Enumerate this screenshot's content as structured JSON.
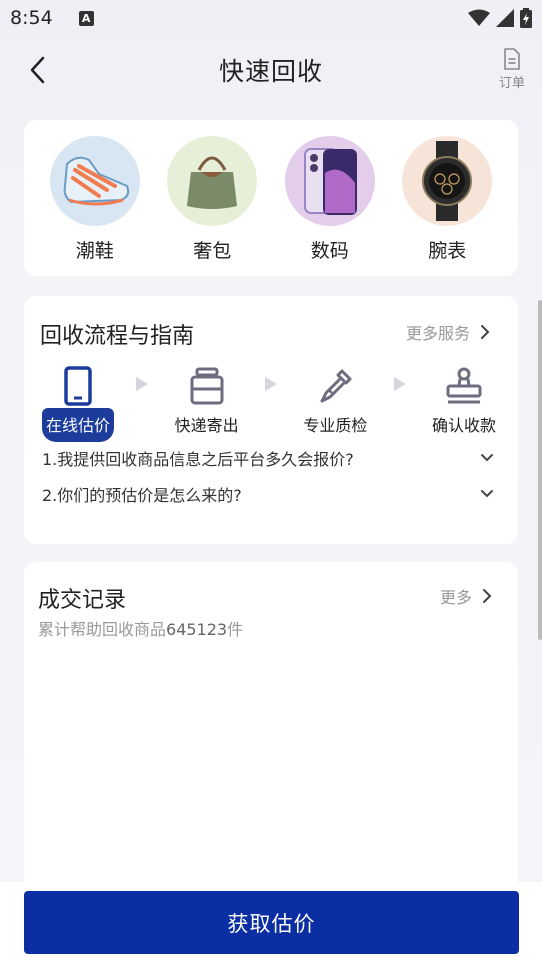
{
  "status": {
    "time": "8:54",
    "notif_letter": "A"
  },
  "nav": {
    "title": "快速回收",
    "order_label": "订单"
  },
  "categories": [
    {
      "label": "潮鞋",
      "icon": "sneaker-icon",
      "bg": "#d7e6f2"
    },
    {
      "label": "奢包",
      "icon": "handbag-icon",
      "bg": "#e8efd8"
    },
    {
      "label": "数码",
      "icon": "phone-icon",
      "bg": "#e3cdea"
    },
    {
      "label": "腕表",
      "icon": "watch-icon",
      "bg": "#f7e4d8"
    }
  ],
  "guide": {
    "title": "回收流程与指南",
    "more": "更多服务",
    "steps": [
      {
        "label": "在线估价",
        "icon": "phone-outline-icon",
        "active": true
      },
      {
        "label": "快递寄出",
        "icon": "package-icon",
        "active": false
      },
      {
        "label": "专业质检",
        "icon": "dropper-icon",
        "active": false
      },
      {
        "label": "确认收款",
        "icon": "stamp-icon",
        "active": false
      }
    ],
    "faq": [
      {
        "text": "1.我提供回收商品信息之后平台多久会报价?"
      },
      {
        "text": "2.你们的预估价是怎么来的?"
      }
    ]
  },
  "deals": {
    "title": "成交记录",
    "more": "更多",
    "stat_prefix": "累计帮助回收商品",
    "stat_count": "645123",
    "stat_suffix": "件"
  },
  "cta": {
    "label": "获取估价"
  },
  "colors": {
    "primary": "#0b2fa3",
    "active_step": "#1b3c9a",
    "muted": "#999999"
  }
}
